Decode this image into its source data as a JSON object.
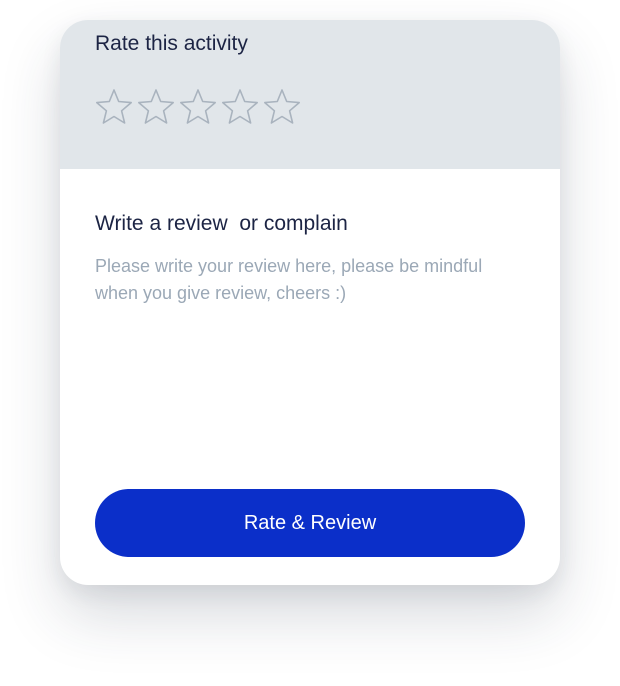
{
  "rating": {
    "title": "Rate this activity",
    "value": 0,
    "max": 5,
    "stars": [
      {
        "icon": "star-outline-icon"
      },
      {
        "icon": "star-outline-icon"
      },
      {
        "icon": "star-outline-icon"
      },
      {
        "icon": "star-outline-icon"
      },
      {
        "icon": "star-outline-icon"
      }
    ]
  },
  "review": {
    "title": "Write a review  or complain",
    "value": "",
    "placeholder": "Please write your review here, please be mindful when you give review, cheers :)"
  },
  "submit": {
    "label": "Rate & Review"
  },
  "colors": {
    "header_background": "#e1e6ea",
    "star_outline": "#a9b3be",
    "title_text": "#1c2444",
    "placeholder_text": "#9ba8b6",
    "button_background": "#0b2fc9",
    "button_text": "#ffffff"
  }
}
